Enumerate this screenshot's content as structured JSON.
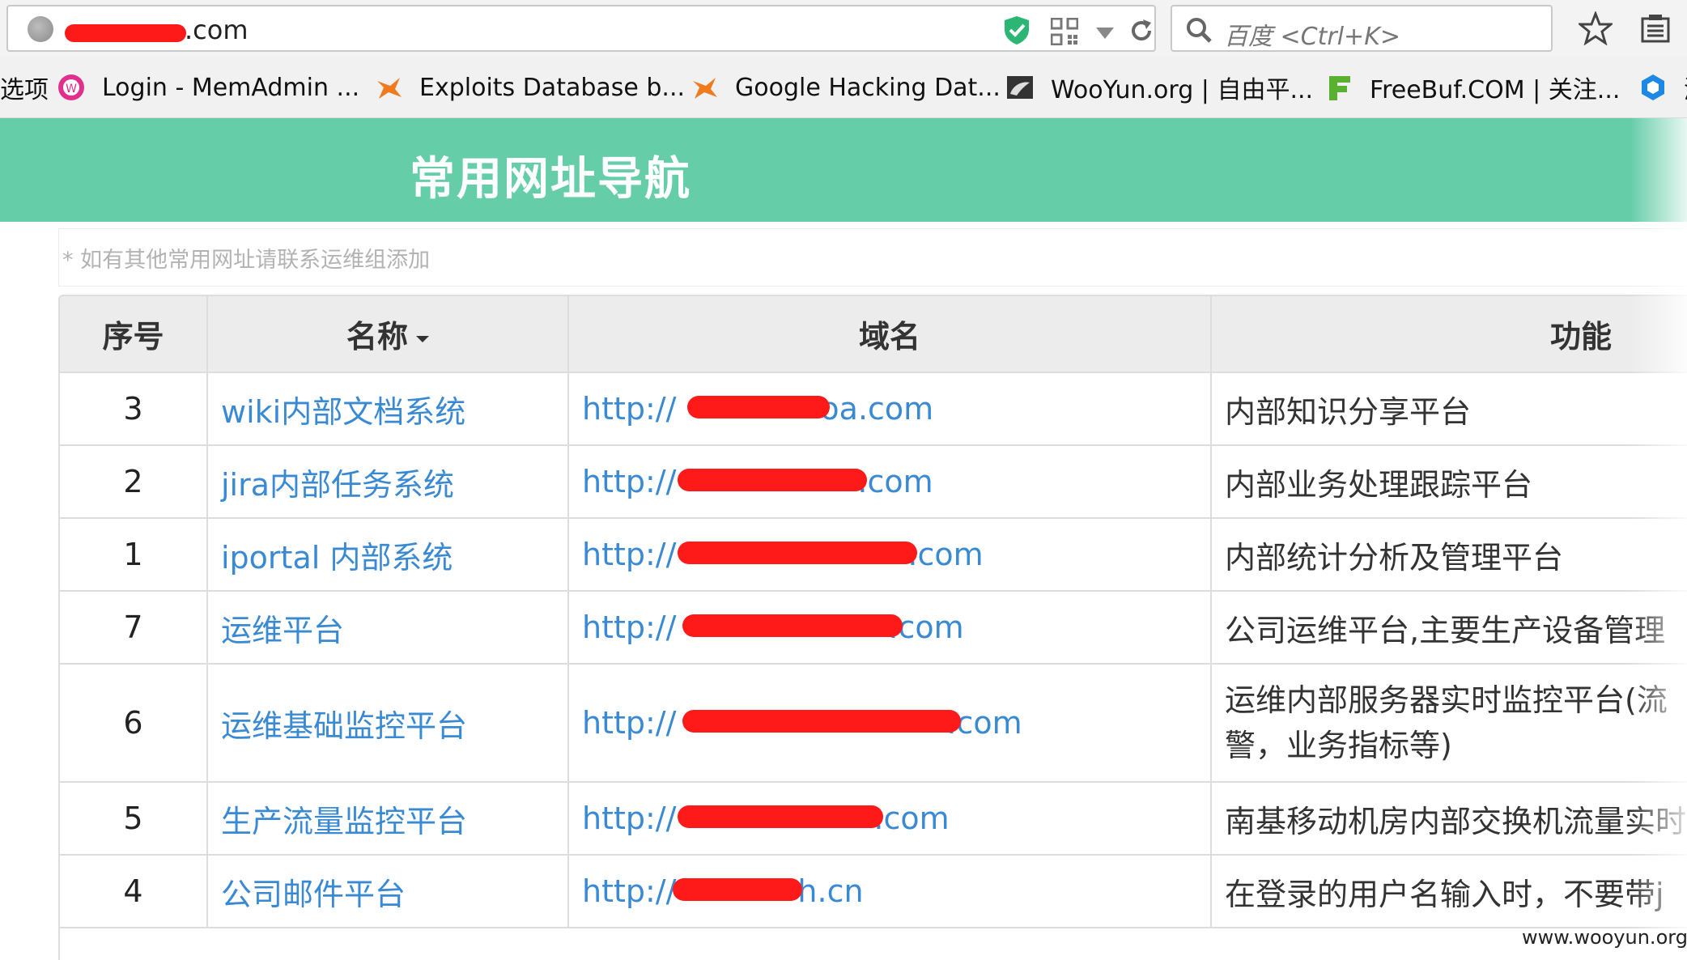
{
  "browser": {
    "url_suffix": ".com",
    "search_placeholder": "百度 <Ctrl+K>"
  },
  "bookmarks": [
    {
      "label": "选项",
      "icon": "none"
    },
    {
      "label": "Login - MemAdmin ...",
      "icon": "memadmin-icon"
    },
    {
      "label": "Exploits Database b...",
      "icon": "exploitdb-icon"
    },
    {
      "label": "Google Hacking Dat...",
      "icon": "exploitdb-icon"
    },
    {
      "label": "WooYun.org | 自由平...",
      "icon": "wooyun-icon"
    },
    {
      "label": "FreeBuf.COM | 关注...",
      "icon": "freebuf-icon"
    },
    {
      "label": "湖",
      "icon": "hex-icon"
    }
  ],
  "page": {
    "title": "常用网址导航",
    "note": "* 如有其他常用网址请联系运维组添加"
  },
  "table": {
    "headers": {
      "num": "序号",
      "name": "名称",
      "domain": "域名",
      "func": "功能"
    },
    "rows": [
      {
        "num": "3",
        "name": "wiki内部文档系统",
        "domain_prefix": "http://",
        "domain_suffix": "oa.com",
        "desc": "内部知识分享平台"
      },
      {
        "num": "2",
        "name": "jira内部任务系统",
        "domain_prefix": "http://",
        "domain_suffix": ".com",
        "desc": "内部业务处理跟踪平台"
      },
      {
        "num": "1",
        "name": "iportal 内部系统",
        "domain_prefix": "http://",
        "domain_suffix": ".com",
        "desc": "内部统计分析及管理平台"
      },
      {
        "num": "7",
        "name": "运维平台",
        "domain_prefix": "http://",
        "domain_suffix": ".com",
        "desc": "公司运维平台,主要生产设备管理"
      },
      {
        "num": "6",
        "name": "运维基础监控平台",
        "domain_prefix": "http://",
        "domain_suffix": ".com",
        "desc": "运维内部服务器实时监控平台(流警，业务指标等)"
      },
      {
        "num": "5",
        "name": "生产流量监控平台",
        "domain_prefix": "http://",
        "domain_suffix": ".com",
        "desc": "南基移动机房内部交换机流量实时"
      },
      {
        "num": "4",
        "name": "公司邮件平台",
        "domain_prefix": "http://",
        "domain_suffix": "h.cn",
        "desc": "在登录的用户名输入时，不要带j"
      }
    ]
  },
  "watermark": "www.wooyun.org",
  "colors": {
    "header_green": "#66cda9",
    "link_blue": "#3a8ad3",
    "redaction": "#ff1a1a"
  }
}
